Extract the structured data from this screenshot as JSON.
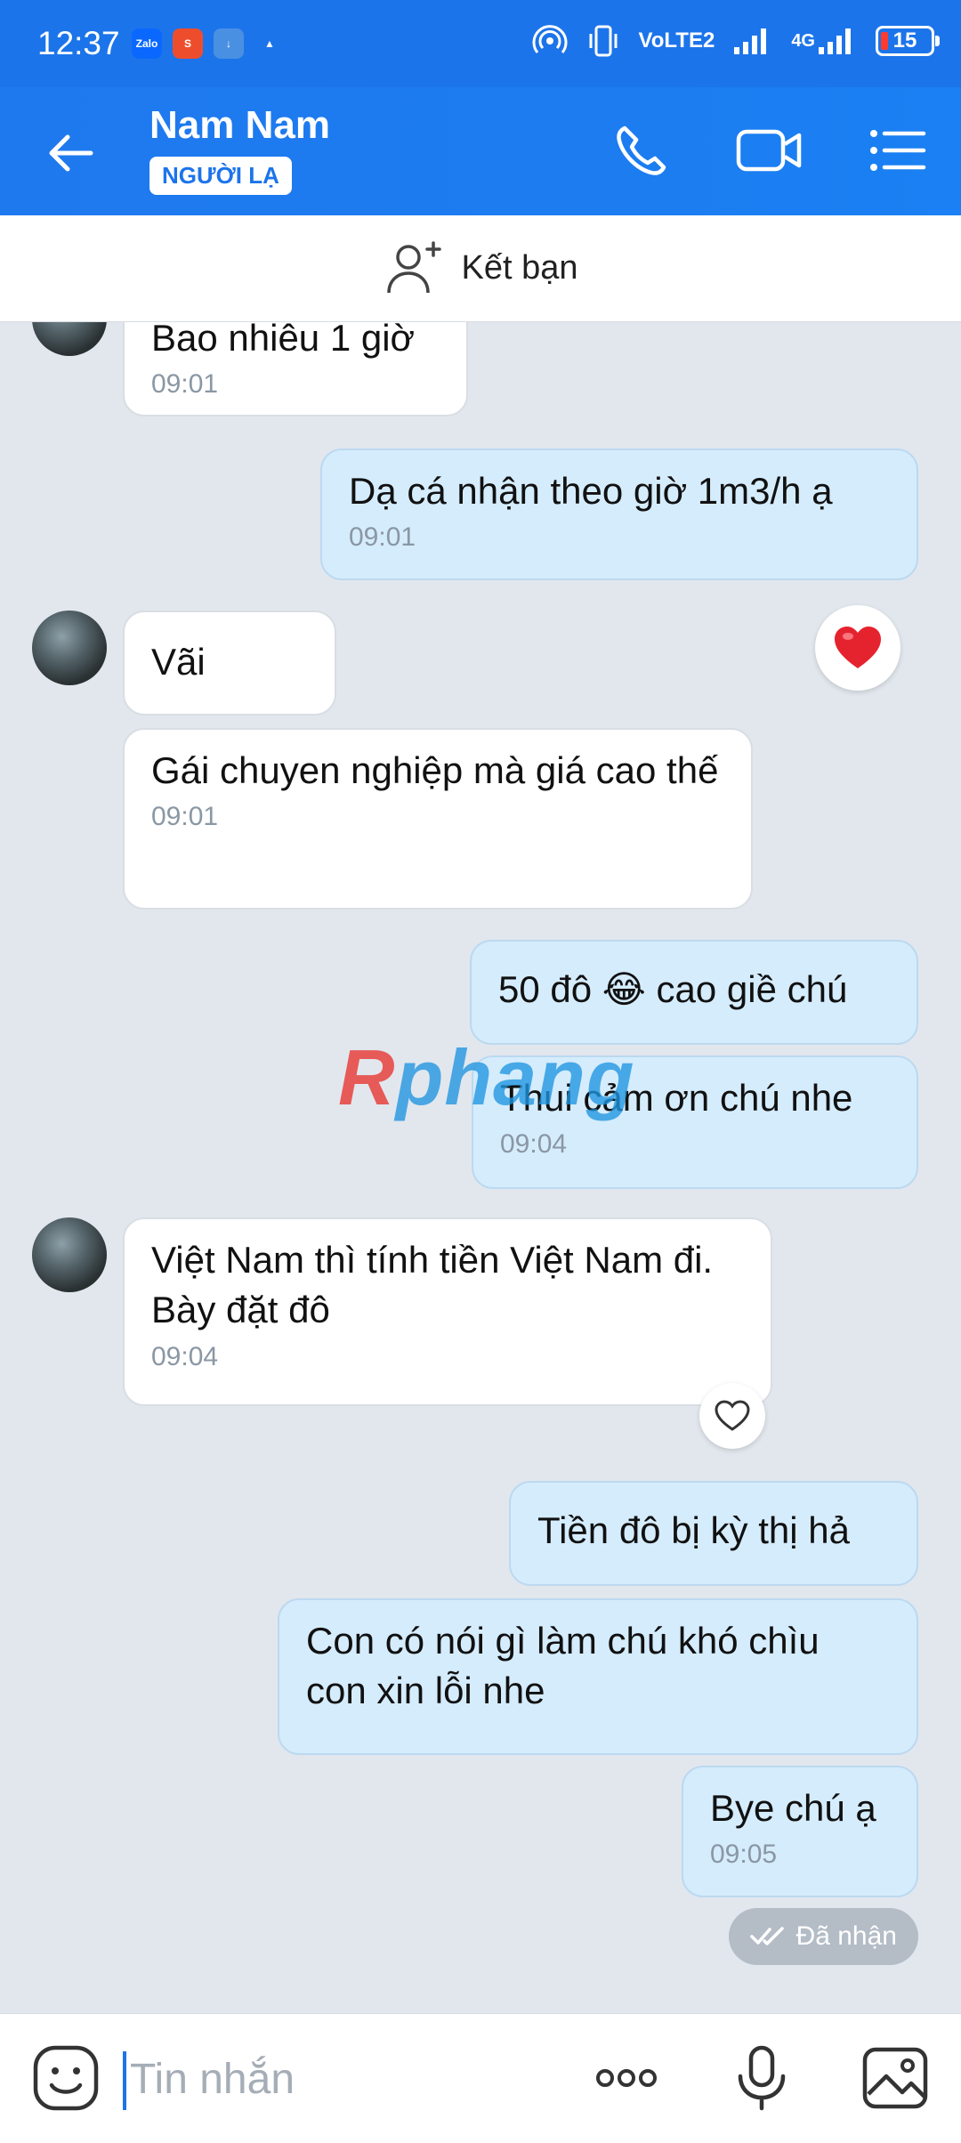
{
  "status_bar": {
    "time": "12:37",
    "apps": [
      {
        "name": "zalo-icon",
        "text": "Zalo",
        "color": "#0a68ff"
      },
      {
        "name": "shopee-icon",
        "text": "S",
        "color": "#ee4d2d"
      },
      {
        "name": "download-icon",
        "text": "↓",
        "color": "#4a90e2"
      },
      {
        "name": "warning-icon",
        "text": "▲",
        "color": "#1c74ea"
      }
    ],
    "network_label": "VoLTE2",
    "network_type": "4G",
    "battery": "15"
  },
  "header": {
    "contact_name": "Nam Nam",
    "badge": "NGƯỜI LẠ"
  },
  "friend_bar": {
    "label": "Kết bạn"
  },
  "messages": [
    {
      "side": "in",
      "text": "Bao nhiêu 1 giờ",
      "time": "09:01"
    },
    {
      "side": "out",
      "text": "Dạ cá nhận theo giờ 1m3/h ạ",
      "time": "09:01"
    },
    {
      "side": "in",
      "text": "Vãi",
      "time": ""
    },
    {
      "side": "in",
      "text": "Gái chuyen nghiệp mà giá cao thế",
      "time": "09:01"
    },
    {
      "side": "out",
      "text": "50 đô 😂 cao giề chú",
      "time": ""
    },
    {
      "side": "out",
      "text": "Thui cảm ơn chú nhe",
      "time": "09:04"
    },
    {
      "side": "in",
      "text": "Việt Nam thì tính tiền Việt Nam đi. Bày đặt đô",
      "time": "09:04"
    },
    {
      "side": "out",
      "text": "Tiền đô bị kỳ thị hả",
      "time": ""
    },
    {
      "side": "out",
      "text": "Con có nói gì làm chú khó chìu con xin lỗi nhe",
      "time": ""
    },
    {
      "side": "out",
      "text": "Bye chú ạ",
      "time": "09:05"
    }
  ],
  "delivery_status": "Đã nhận",
  "watermark": {
    "part1": "R",
    "part2": "phang"
  },
  "input": {
    "placeholder": "Tin nhắn"
  },
  "colors": {
    "accent": "#1c74ea",
    "chat_bg": "#e2e7ee",
    "outgoing_bubble": "#d5ecfd",
    "incoming_bubble": "#ffffff",
    "reaction_heart": "#e5232f"
  }
}
